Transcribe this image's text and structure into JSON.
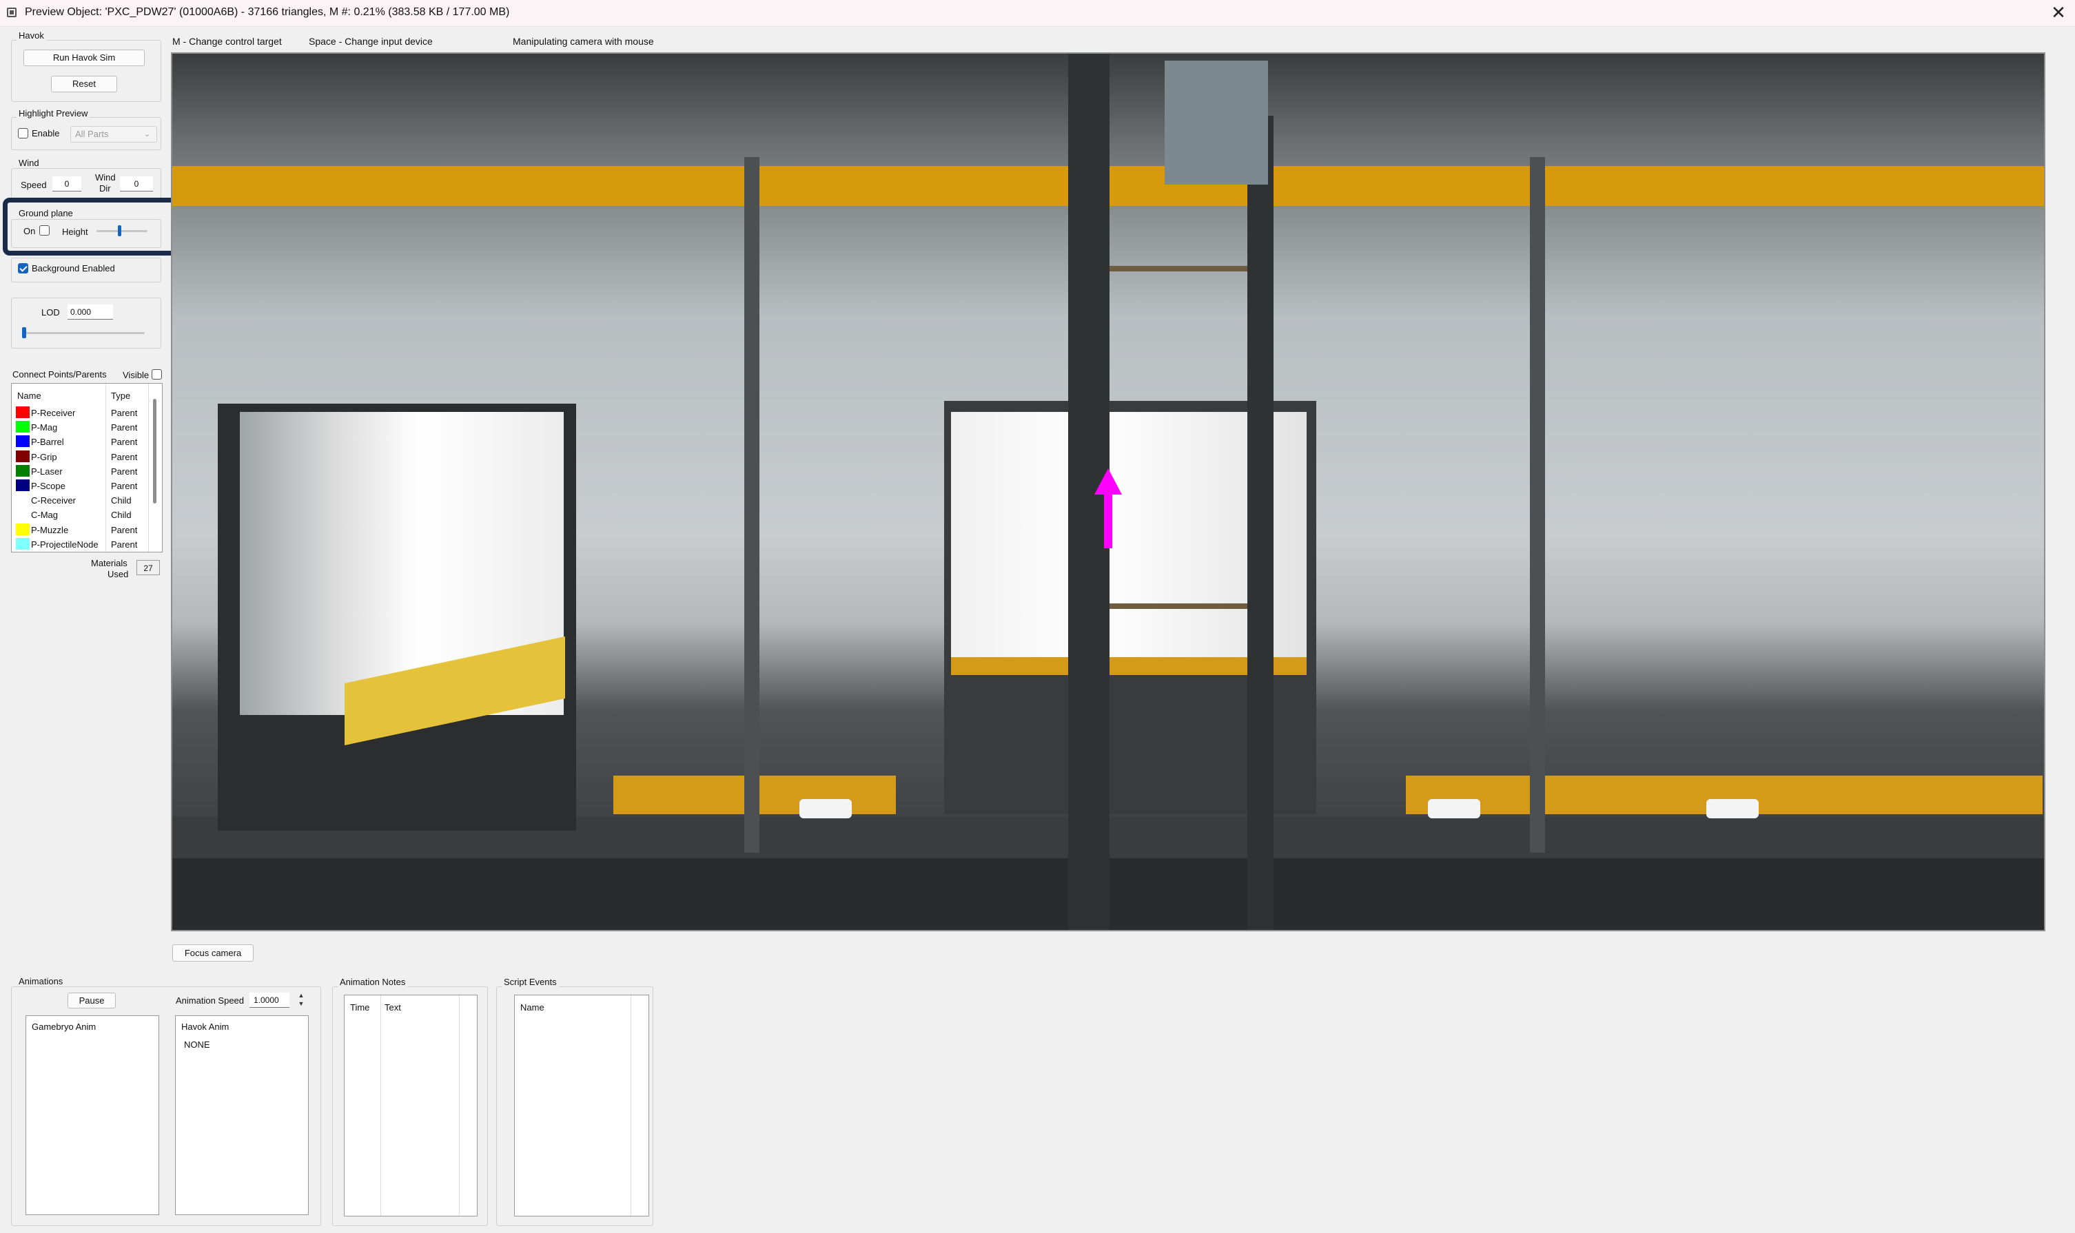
{
  "window": {
    "title": "Preview Object: 'PXC_PDW27' (01000A6B) - 37166 triangles, M #: 0.21% (383.58 KB / 177.00 MB)",
    "close_glyph": "✕"
  },
  "help_bar": {
    "control_target": "M - Change control target",
    "input_device": "Space - Change input device",
    "status": "Manipulating camera with mouse"
  },
  "havok": {
    "title": "Havok",
    "run_label": "Run Havok Sim",
    "reset_label": "Reset"
  },
  "highlight_preview": {
    "title": "Highlight Preview",
    "enable_label": "Enable",
    "enabled": false,
    "select_value": "All Parts"
  },
  "wind": {
    "title": "Wind",
    "speed_label": "Speed",
    "speed_value": "0",
    "dir_label_1": "Wind",
    "dir_label_2": "Dir",
    "dir_value": "0"
  },
  "ground_plane": {
    "title": "Ground plane",
    "on_label": "On",
    "on": false,
    "height_label": "Height",
    "height_level": 0.45
  },
  "background": {
    "label": "Background Enabled",
    "enabled": true
  },
  "lod": {
    "label": "LOD",
    "value": "0.000",
    "slider_level": 0.0
  },
  "connect_points": {
    "title": "Connect Points/Parents",
    "visible_label": "Visible",
    "visible": false,
    "col_name": "Name",
    "col_type": "Type",
    "rows": [
      {
        "name": "P-Receiver",
        "type": "Parent",
        "color": "#ff0000"
      },
      {
        "name": "P-Mag",
        "type": "Parent",
        "color": "#00ff00"
      },
      {
        "name": "P-Barrel",
        "type": "Parent",
        "color": "#0000ff"
      },
      {
        "name": "P-Grip",
        "type": "Parent",
        "color": "#800000"
      },
      {
        "name": "P-Laser",
        "type": "Parent",
        "color": "#008000"
      },
      {
        "name": "P-Scope",
        "type": "Parent",
        "color": "#000080"
      },
      {
        "name": "C-Receiver",
        "type": "Child",
        "color": ""
      },
      {
        "name": "C-Mag",
        "type": "Child",
        "color": ""
      },
      {
        "name": "P-Muzzle",
        "type": "Parent",
        "color": "#ffff00"
      },
      {
        "name": "P-ProjectileNode",
        "type": "Parent",
        "color": "#80ffff"
      }
    ]
  },
  "materials": {
    "label_1": "Materials",
    "label_2": "Used",
    "value": "27"
  },
  "focus_camera_label": "Focus camera",
  "animations": {
    "title": "Animations",
    "pause_label": "Pause",
    "speed_label": "Animation Speed",
    "speed_value": "1.0000",
    "gamebryo_header": "Gamebryo Anim",
    "havok_header": "Havok Anim",
    "havok_items": [
      "NONE"
    ]
  },
  "animation_notes": {
    "title": "Animation Notes",
    "col_time": "Time",
    "col_text": "Text"
  },
  "script_events": {
    "title": "Script Events",
    "col_name": "Name"
  },
  "colors": {
    "accent": "#1565c0",
    "highlight_border": "#1b2b4a",
    "arrow": "#ff00ff"
  }
}
